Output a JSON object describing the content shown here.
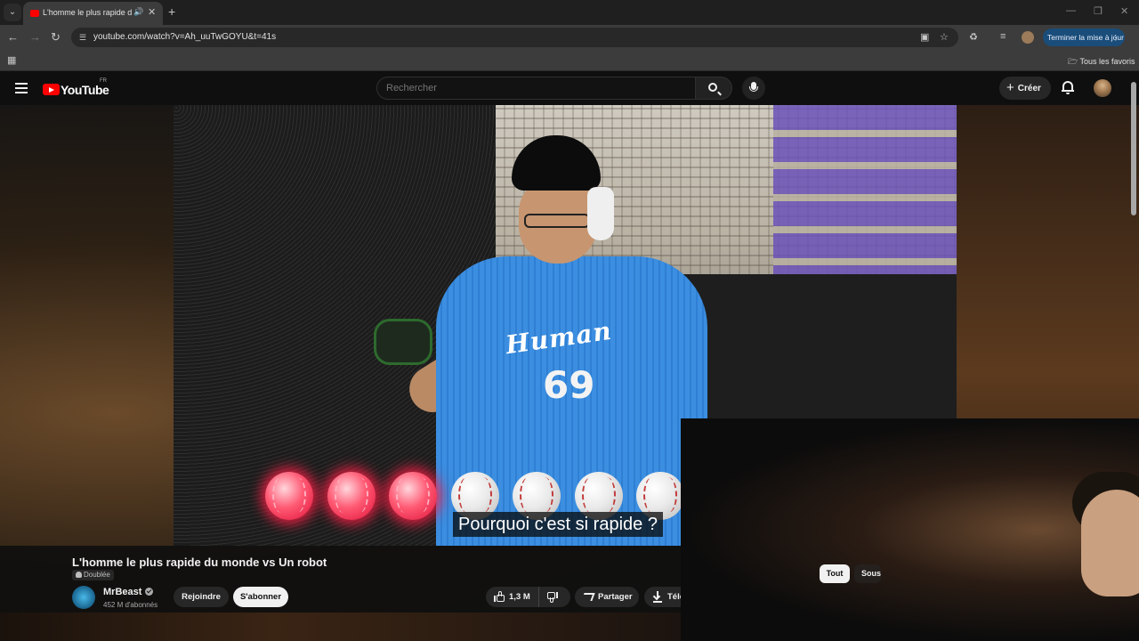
{
  "browser": {
    "tab": {
      "title": "L'homme le plus rapide du monde vs Un robot - YouTube",
      "title_display": "L'homme le plus rapide du"
    },
    "url": "youtube.com/watch?v=Ah_uuTwGOYU&t=41s",
    "update_button": "Terminer la mise à jour",
    "bookmarks_folder": "Tous les favoris"
  },
  "youtube": {
    "region": "FR",
    "logo_text": "YouTube",
    "search_placeholder": "Rechercher",
    "create_label": "Créer",
    "video": {
      "subtitle": "Pourquoi c'est si rapide ?",
      "jersey_text": "Human",
      "jersey_number": "69",
      "balls_total": 10,
      "balls_lit": 3
    },
    "title": "L'homme le plus rapide du monde vs Un robot",
    "dubbed_badge": "Doublée",
    "channel": {
      "name": "MrBeast",
      "subscribers": "452 M d'abonnés"
    },
    "join_label": "Rejoindre",
    "subscribe_label": "S'abonner",
    "likes": "1,3 M",
    "share_label": "Partager",
    "download_label": "Télécharger",
    "chips": [
      "Tout",
      "Sous-titres"
    ]
  },
  "colors": {
    "accent_red": "#ff0000",
    "ball_lit": "#ff2a4a",
    "jersey_blue": "#3b8ee0",
    "update_blue": "#1a4d7a"
  },
  "icons": [
    "menu-icon",
    "search-icon",
    "mic-icon",
    "plus-icon",
    "bell-icon",
    "verified-icon",
    "like-icon",
    "dislike-icon",
    "share-icon",
    "download-icon"
  ]
}
